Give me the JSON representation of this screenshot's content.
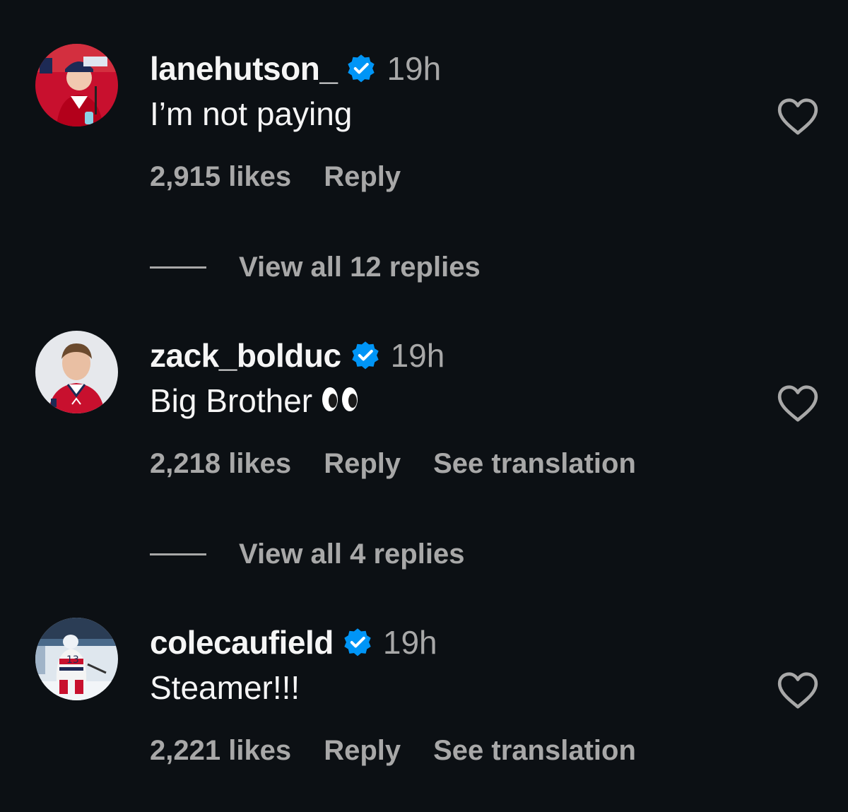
{
  "comments": [
    {
      "username": "lanehutson_",
      "verified": true,
      "time": "19h",
      "text": "I’m not paying",
      "likes": "2,915 likes",
      "reply": "Reply",
      "translation": null,
      "view_replies": "View all 12 replies"
    },
    {
      "username": "zack_bolduc",
      "verified": true,
      "time": "19h",
      "text": "Big Brother",
      "emoji": "eyes",
      "likes": "2,218 likes",
      "reply": "Reply",
      "translation": "See translation",
      "view_replies": "View all 4 replies"
    },
    {
      "username": "colecaufield",
      "verified": true,
      "time": "19h",
      "text": "Steamer!!!",
      "likes": "2,221 likes",
      "reply": "Reply",
      "translation": "See translation"
    }
  ],
  "colors": {
    "background": "#0c1014",
    "primary_text": "#f5f5f5",
    "secondary_text": "#a8a8a8",
    "verified_badge": "#0095f6"
  },
  "icons": {
    "verified": "verified-badge-icon",
    "like": "heart-outline-icon",
    "emoji": "eyes-emoji-icon"
  }
}
